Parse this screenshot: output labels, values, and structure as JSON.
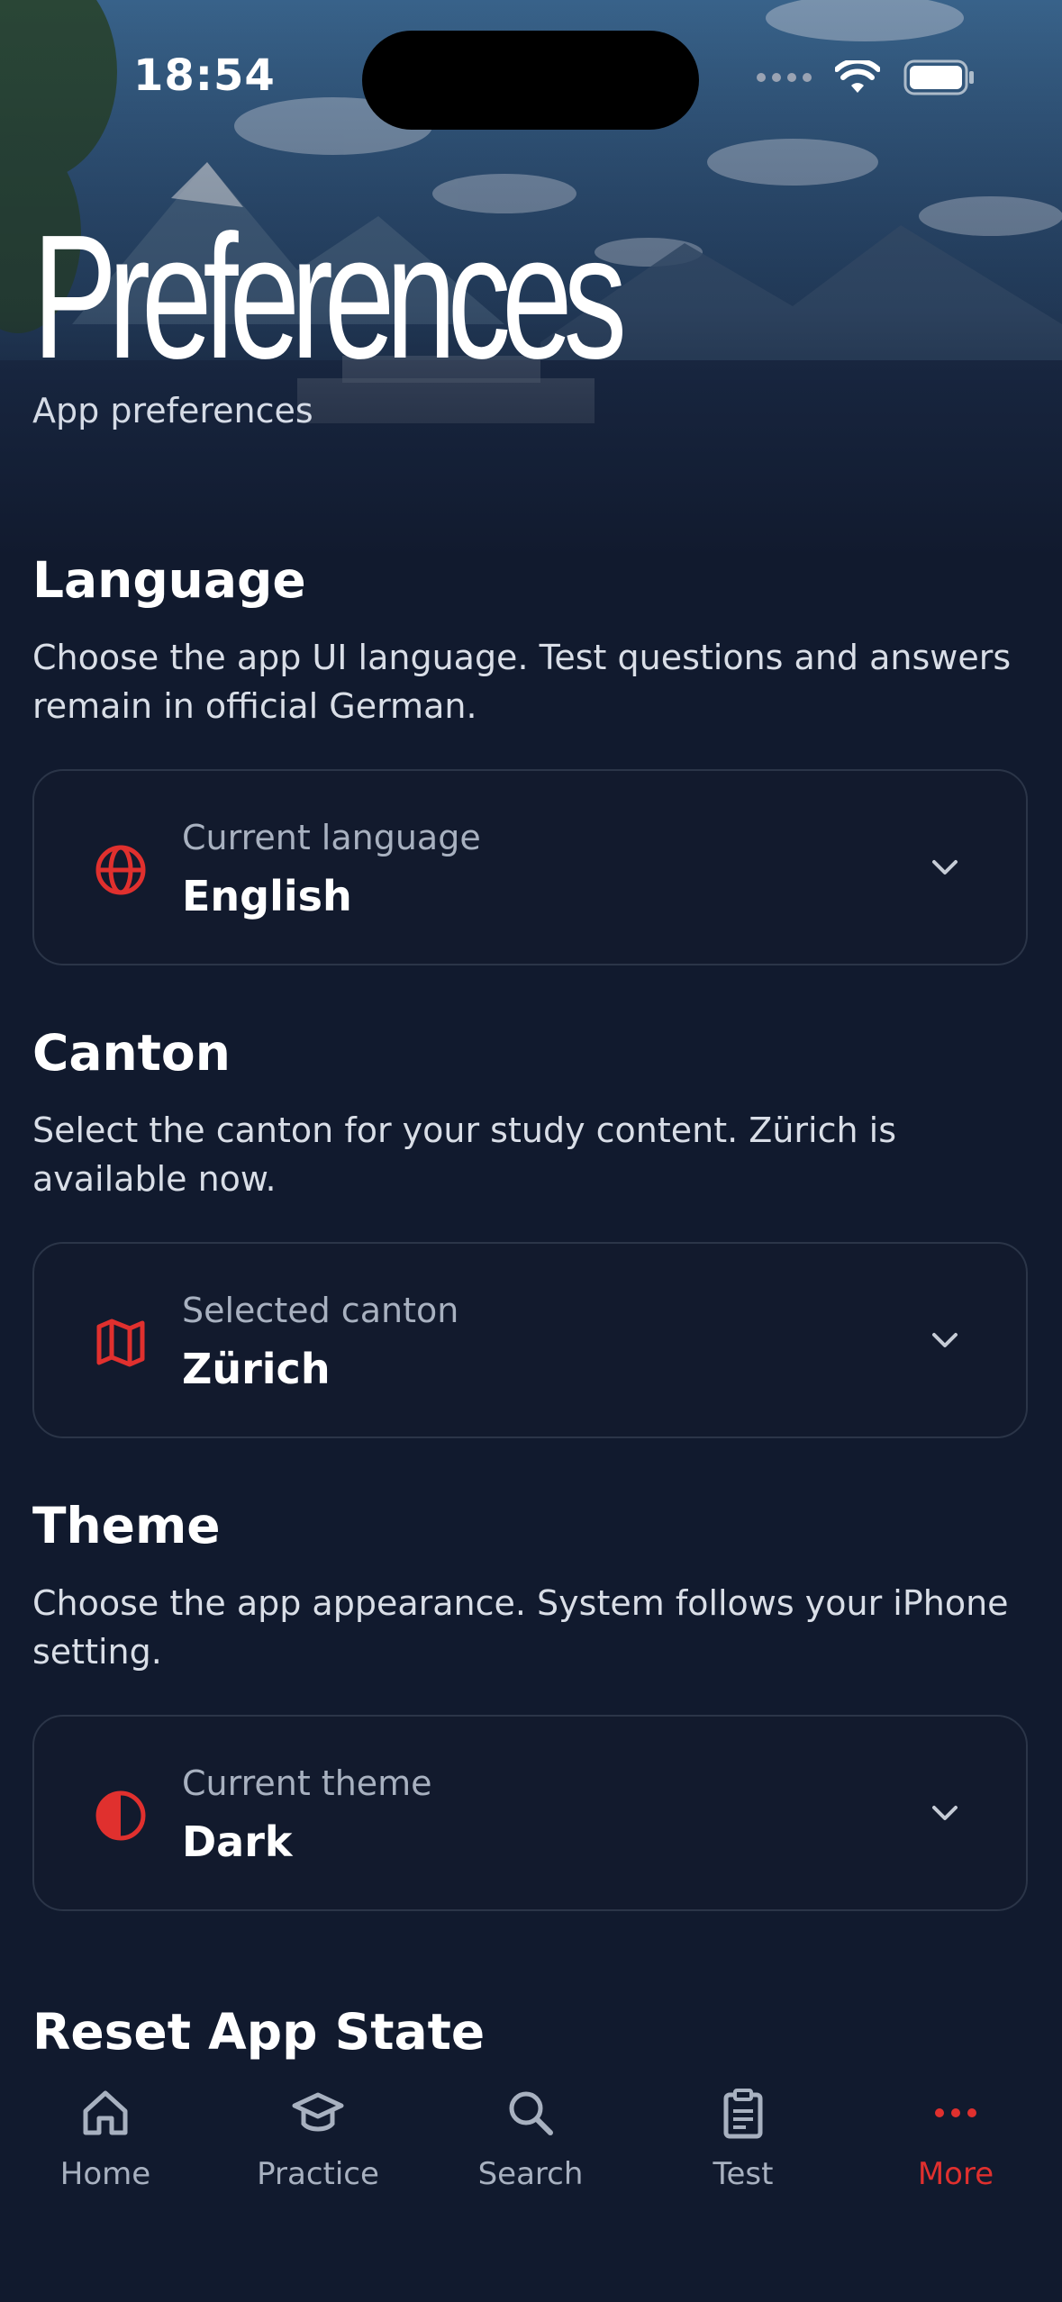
{
  "status_bar": {
    "time": "18:54"
  },
  "header": {
    "title": "Preferences",
    "subtitle": "App preferences"
  },
  "sections": [
    {
      "title": "Language",
      "description": "Choose the app UI language. Test questions and answers remain in official German.",
      "card": {
        "icon": "globe-icon",
        "label": "Current language",
        "value": "English"
      }
    },
    {
      "title": "Canton",
      "description": "Select the canton for your study content. Zürich is available now.",
      "card": {
        "icon": "map-icon",
        "label": "Selected canton",
        "value": "Zürich"
      }
    },
    {
      "title": "Theme",
      "description": "Choose the app appearance. System follows your iPhone setting.",
      "card": {
        "icon": "contrast-icon",
        "label": "Current theme",
        "value": "Dark"
      }
    },
    {
      "title": "Reset App State"
    }
  ],
  "tabbar": {
    "items": [
      {
        "label": "Home",
        "icon": "home-icon"
      },
      {
        "label": "Practice",
        "icon": "graduation-cap-icon"
      },
      {
        "label": "Search",
        "icon": "search-icon"
      },
      {
        "label": "Test",
        "icon": "clipboard-icon"
      },
      {
        "label": "More",
        "icon": "more-dots-icon",
        "active": true
      }
    ]
  },
  "colors": {
    "accent": "#e0302e",
    "background": "#111a2e",
    "muted": "#a8b1c0"
  }
}
